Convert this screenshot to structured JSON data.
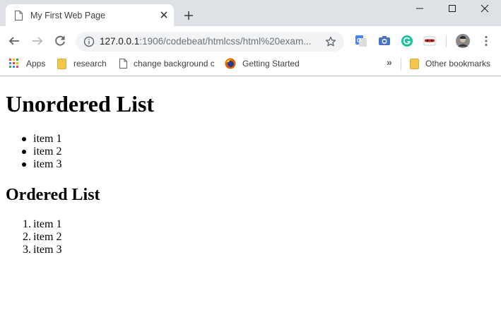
{
  "browser": {
    "tab": {
      "title": "My First Web Page",
      "close_glyph": "✕"
    },
    "new_tab_glyph": "+",
    "window_controls": {
      "minimize": "—",
      "maximize": "☐",
      "close": "✕"
    },
    "address": {
      "host": "127.0.0.1",
      "path": ":1906/codebeat/htmlcss/html%20exam..."
    },
    "bookmarks": [
      {
        "label": "Apps",
        "icon": "apps-grid-icon"
      },
      {
        "label": "research",
        "icon": "folder-icon"
      },
      {
        "label": "change background c",
        "icon": "page-icon"
      },
      {
        "label": "Getting Started",
        "icon": "firefox-icon"
      }
    ],
    "bookmarks_overflow": "»",
    "other_bookmarks": "Other bookmarks",
    "extensions": [
      "google-translate-icon",
      "camera-icon",
      "grammarly-icon",
      "incognito-mask-icon",
      "profile-avatar-icon"
    ]
  },
  "page": {
    "heading1": "Unordered List",
    "unordered_items": [
      "item 1",
      "item 2",
      "item 3"
    ],
    "heading2": "Ordered List",
    "ordered_items": [
      "item 1",
      "item 2",
      "item 3"
    ],
    "ordered_markers": [
      "1.",
      "2.",
      "3."
    ]
  },
  "colors": {
    "tabstrip": "#dee1e6",
    "omnibox": "#f1f3f4",
    "url_host": "#202124",
    "url_path": "#6f7479",
    "folder": "#f4c64b",
    "grammarly": "#15c39a"
  }
}
